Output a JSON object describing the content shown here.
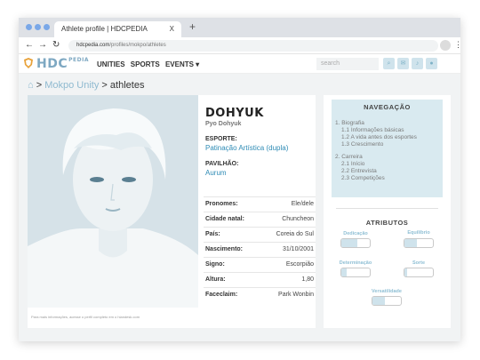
{
  "browser": {
    "tab_title": "Athlete profile | HDCPEDIA",
    "tab_close": "X",
    "new_tab": "+",
    "url_domain": "hdcpedia.com",
    "url_path": "/profiles/mokpo/athletes"
  },
  "site": {
    "logo_text": "HDC",
    "logo_sup": "PEDIA",
    "menu": [
      "UNITIES",
      "SPORTS",
      "EVENTS ▾"
    ],
    "search_placeholder": "search"
  },
  "breadcrumb": {
    "unity": "Mokpo Unity",
    "sep": ">",
    "page": "athletes"
  },
  "athlete": {
    "name": "DOHYUK",
    "full_name": "Pyo Dohyuk",
    "sport_label": "ESPORTE:",
    "sport": "Patinação Artística (dupla)",
    "pavilion_label": "PAVILHÃO:",
    "pavilion": "Aurum",
    "caption": "Para mais informações, acesse o perfil completo em o hiandesk.com"
  },
  "details": [
    {
      "key": "Pronomes:",
      "value": "Ele/dele"
    },
    {
      "key": "Cidade natal:",
      "value": "Chuncheon"
    },
    {
      "key": "País:",
      "value": "Coreia do Sul"
    },
    {
      "key": "Nascimento:",
      "value": "31/10/2001"
    },
    {
      "key": "Signo:",
      "value": "Escorpião"
    },
    {
      "key": "Altura:",
      "value": "1,80"
    },
    {
      "key": "Faceclaim:",
      "value": "Park Wonbin"
    }
  ],
  "navigation": {
    "title": "NAVEGAÇÃO",
    "items": [
      "1. Biografia",
      "1.1 Informações básicas",
      "1.2 A vida antes dos esportes",
      "1.3 Crescimento",
      "2. Carreira",
      "2.1 Início",
      "2.2 Entrevista",
      "2.3 Competições"
    ]
  },
  "attributes": {
    "title": "ATRIBUTOS",
    "items": [
      {
        "label": "Dedicação",
        "level": 0.55
      },
      {
        "label": "Equilíbrio",
        "level": 0.45
      },
      {
        "label": "Determinação",
        "level": 0.2
      },
      {
        "label": "Sorte",
        "level": 0.1
      },
      {
        "label": "Versatilidade",
        "level": 0.45
      }
    ]
  },
  "colors": {
    "accent": "#8fbad0",
    "link": "#2e8bb5",
    "nav_bg": "#d9eaf0",
    "bar_fill": "#cfe3ec"
  }
}
